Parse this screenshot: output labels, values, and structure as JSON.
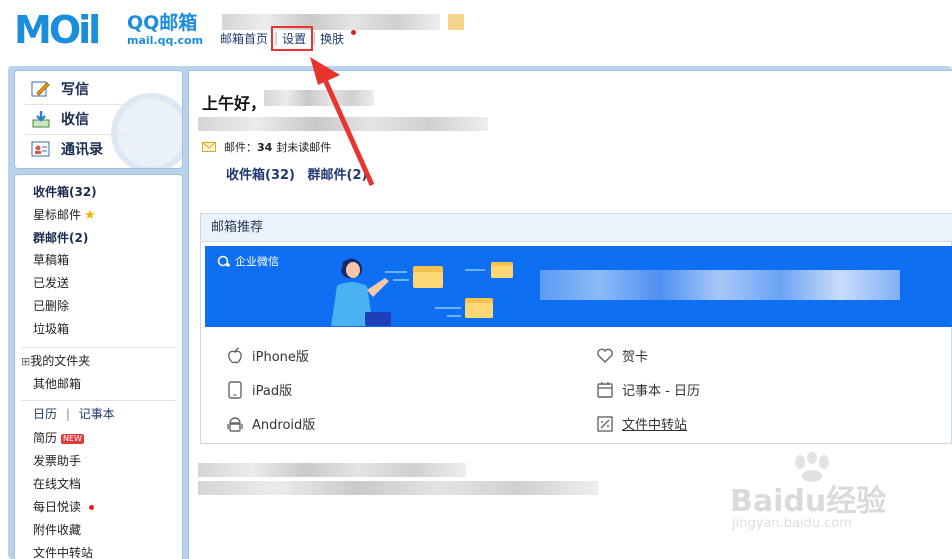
{
  "logo": {
    "mail_word": "MOil",
    "brand": "QQ邮箱",
    "url": "mail.qq.com"
  },
  "topnav": {
    "home": "邮箱首页",
    "settings": "设置",
    "skin": "换肤"
  },
  "sidebar": {
    "compose": "写信",
    "receive": "收信",
    "contacts": "通讯录",
    "folders": [
      {
        "label": "收件箱(32)",
        "bold": true
      },
      {
        "label": "星标邮件",
        "bold": false
      },
      {
        "label": "群邮件(2)",
        "bold": true
      },
      {
        "label": "草稿箱",
        "bold": false
      },
      {
        "label": "已发送",
        "bold": false
      },
      {
        "label": "已删除",
        "bold": false
      },
      {
        "label": "垃圾箱",
        "bold": false
      }
    ],
    "my_folders": "我的文件夹",
    "my_folders_toggle": "⊞",
    "other_mail": "其他邮箱",
    "calendar": "日历",
    "calendar_sep": "|",
    "notebook": "记事本",
    "resume": "简历",
    "new_badge": "NEW",
    "invoice": "发票助手",
    "online_docs": "在线文档",
    "daily_read": "每日悦读",
    "attachments": "附件收藏",
    "file_transfer": "文件中转站"
  },
  "main": {
    "greeting": "上午好，",
    "mail_label": "邮件：",
    "unread_count": "34",
    "unread_suffix": "封未读邮件",
    "inbox_link": "收件箱(32)",
    "group_link": "群邮件(2)",
    "recommend_title": "邮箱推荐",
    "banner_brand": "企业微信",
    "apps_left": [
      "iPhone版",
      "iPad版",
      "Android版"
    ],
    "apps_right": [
      "贺卡",
      "记事本 - 日历",
      "文件中转站"
    ]
  },
  "watermark": {
    "brand": "Baidu经验",
    "url": "jingyan.baidu.com"
  },
  "colors": {
    "accent": "#1a8ddc",
    "frame": "#bad2ec",
    "banner": "#0f6ff2",
    "highlight": "#e8342e"
  }
}
